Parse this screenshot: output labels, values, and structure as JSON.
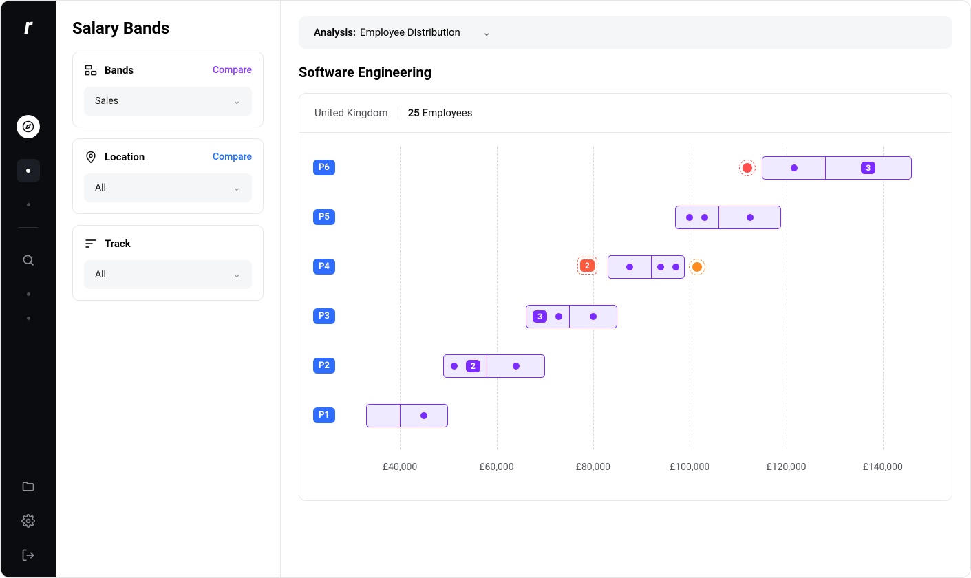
{
  "sidebar": {
    "title": "Salary Bands",
    "panels": {
      "bands": {
        "label": "Bands",
        "compare": "Compare",
        "value": "Sales"
      },
      "location": {
        "label": "Location",
        "compare": "Compare",
        "value": "All"
      },
      "track": {
        "label": "Track",
        "value": "All"
      }
    }
  },
  "main": {
    "analysis": {
      "label": "Analysis:",
      "value": "Employee Distribution"
    },
    "section_title": "Software Engineering",
    "card": {
      "location": "United Kingdom",
      "employee_count": "25",
      "employee_label": "Employees"
    }
  },
  "chart_data": {
    "type": "range-dot",
    "currency": "£",
    "x_ticks": [
      40000,
      60000,
      80000,
      100000,
      120000,
      140000
    ],
    "x_labels": [
      "£40,000",
      "£60,000",
      "£80,000",
      "£100,000",
      "£120,000",
      "£140,000"
    ],
    "x_min": 30000,
    "x_max": 150000,
    "levels": [
      {
        "name": "P6",
        "band_min": 115000,
        "band_mid": 128000,
        "band_max": 146000,
        "lower_dots": [
          "dot"
        ],
        "upper_dots": [
          "badge:3"
        ],
        "outliers": [
          {
            "value": 112000,
            "type": "red",
            "ring": true
          }
        ]
      },
      {
        "name": "P5",
        "band_min": 97000,
        "band_mid": 106000,
        "band_max": 119000,
        "lower_dots": [
          "dot",
          "dot"
        ],
        "upper_dots": [
          "dot"
        ],
        "outliers": []
      },
      {
        "name": "P4",
        "band_min": 83000,
        "band_mid": 92000,
        "band_max": 99000,
        "lower_dots": [
          "dot"
        ],
        "upper_dots": [
          "dot",
          "dot"
        ],
        "outliers": [
          {
            "value": 101500,
            "type": "orange",
            "ring": true
          }
        ],
        "under_band_badge": {
          "value": 79000,
          "text": "2"
        }
      },
      {
        "name": "P3",
        "band_min": 66000,
        "band_mid": 75000,
        "band_max": 85000,
        "lower_dots": [
          "badge:3",
          "dot"
        ],
        "upper_dots": [
          "dot"
        ],
        "outliers": []
      },
      {
        "name": "P2",
        "band_min": 49000,
        "band_mid": 58000,
        "band_max": 70000,
        "lower_dots": [
          "dot",
          "badge:2"
        ],
        "upper_dots": [
          "dot"
        ],
        "outliers": []
      },
      {
        "name": "P1",
        "band_min": 33000,
        "band_mid": 40000,
        "band_max": 50000,
        "lower_dots": [],
        "upper_dots": [
          "dot"
        ],
        "outliers": []
      }
    ]
  }
}
